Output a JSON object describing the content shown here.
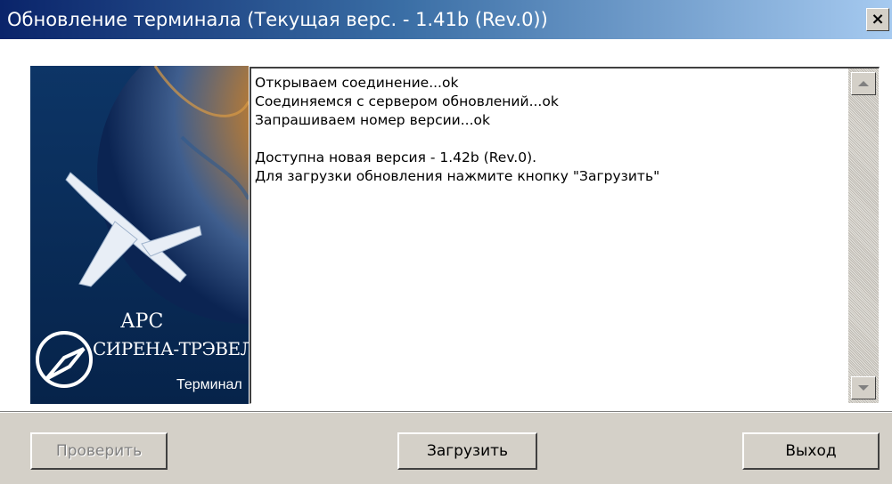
{
  "window": {
    "title": "Обновление терминала (Текущая верс. - 1.41b (Rev.0))",
    "close_label": "×"
  },
  "logo": {
    "line1": "АРС",
    "line2": "СИРЕНА-ТРЭВЕЛ",
    "line3": "Терминал"
  },
  "log": {
    "lines": [
      "Открываем соединение...ok",
      "Соединяемся с сервером обновлений...ok",
      "Запрашиваем номер версии...ok",
      "",
      "Доступна новая версия - 1.42b (Rev.0).",
      "Для загрузки обновления нажмите кнопку \"Загрузить\""
    ]
  },
  "buttons": {
    "check": "Проверить",
    "load": "Загрузить",
    "exit": "Выход"
  },
  "colors": {
    "title_start": "#0a246a",
    "title_end": "#a6caf0",
    "face": "#d4d0c8",
    "logo_bg": "#0a2a5a"
  },
  "icons": {
    "close": "close-icon",
    "scroll_up": "scroll-up-arrow-icon",
    "scroll_down": "scroll-down-arrow-icon",
    "emblem": "airplane-emblem-icon"
  }
}
